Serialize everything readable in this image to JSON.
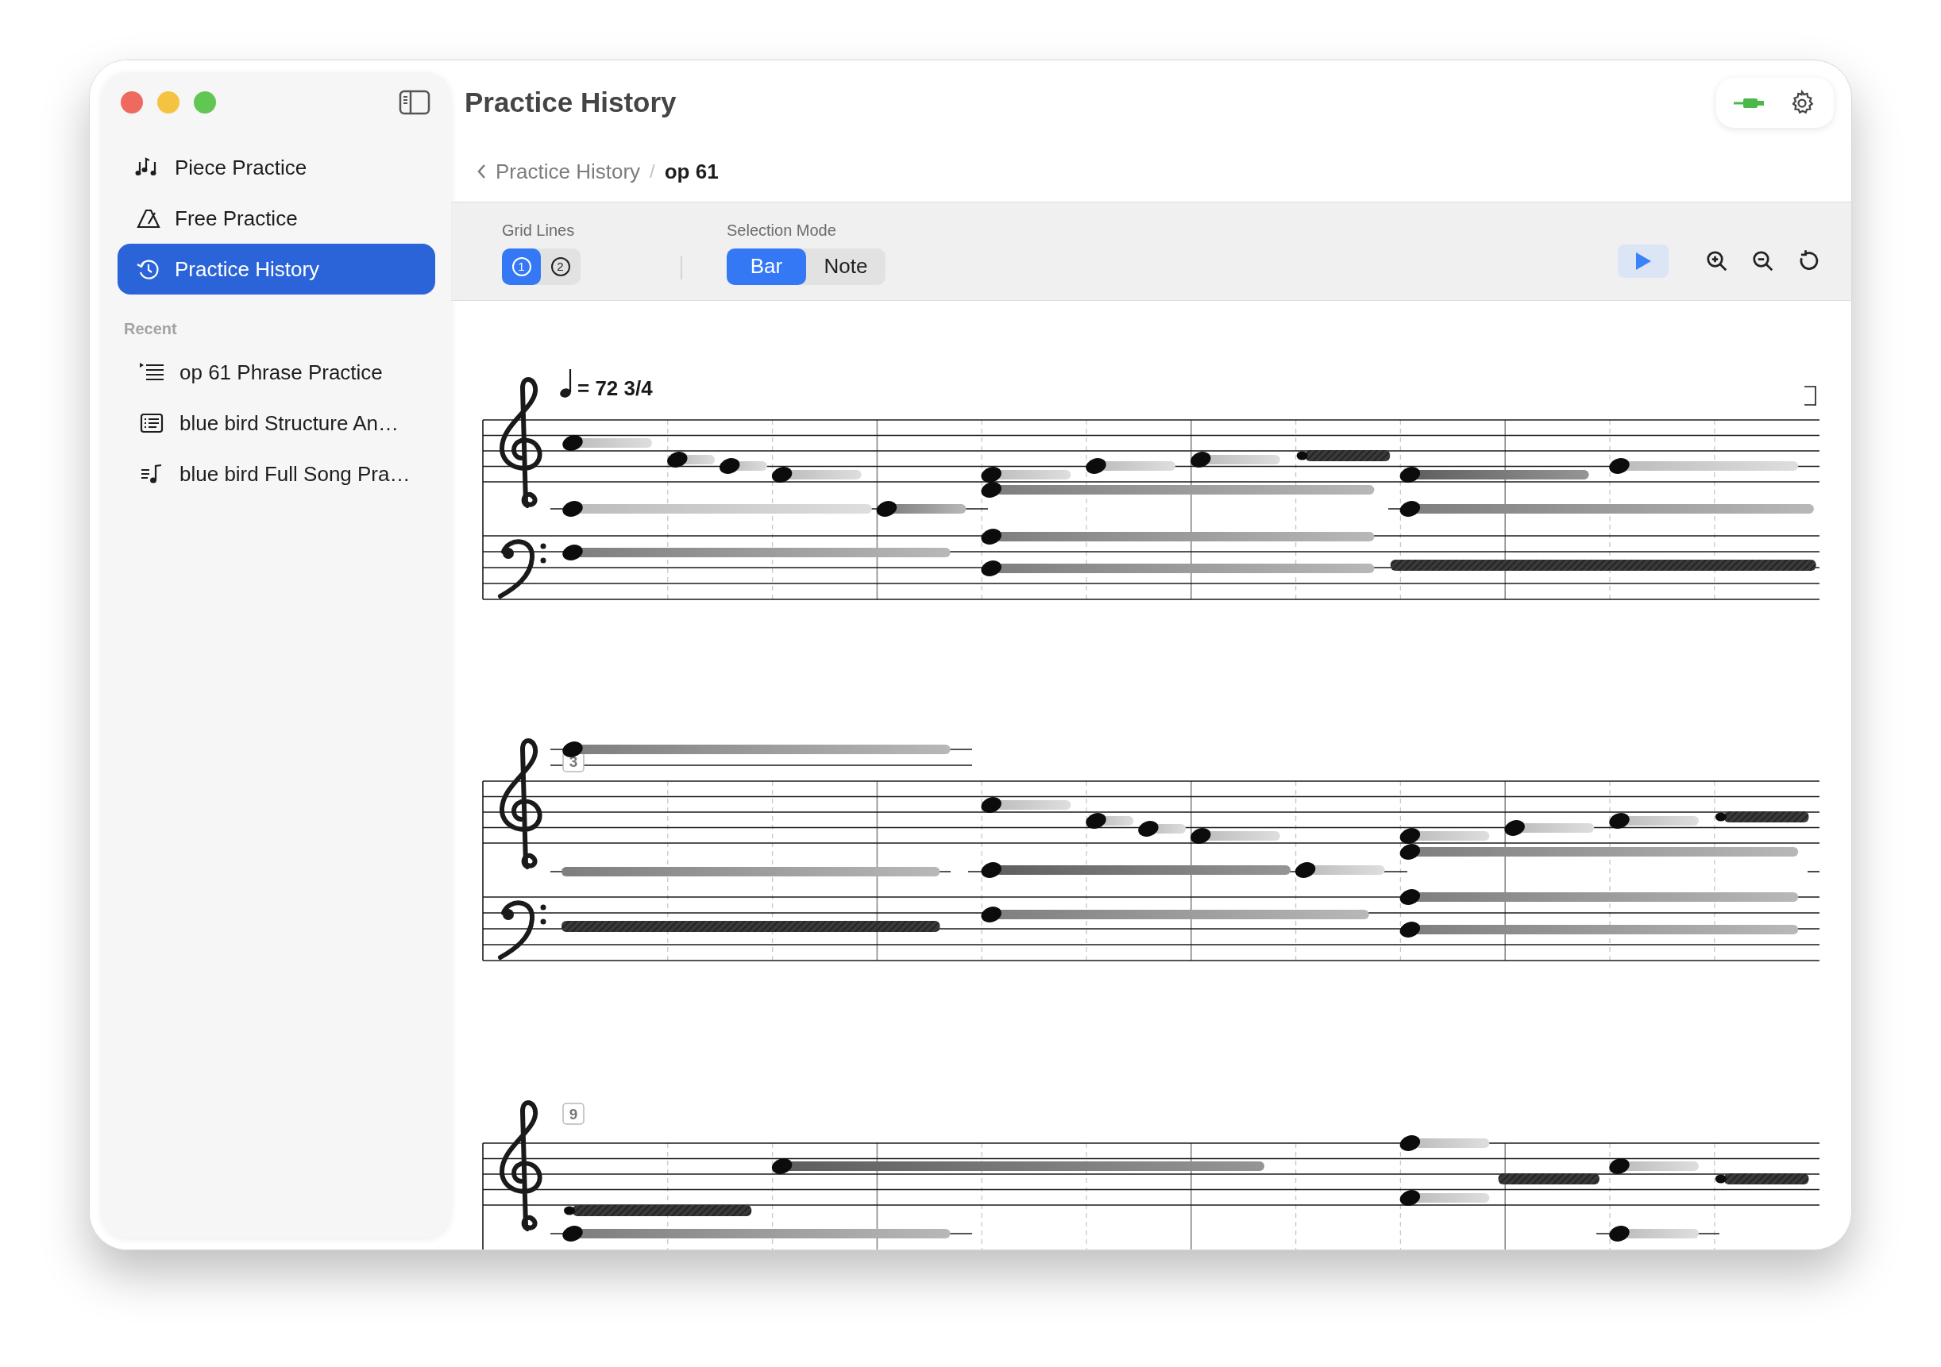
{
  "window": {
    "controls": [
      {
        "color": "#ee6a5f"
      },
      {
        "color": "#f5c342"
      },
      {
        "color": "#62c654"
      }
    ]
  },
  "sidebar": {
    "items": [
      {
        "label": "Piece Practice",
        "kind": "notes",
        "selected": false
      },
      {
        "label": "Free Practice",
        "kind": "metronome",
        "selected": false
      },
      {
        "label": "Practice History",
        "kind": "history",
        "selected": true
      }
    ],
    "recent": {
      "heading": "Recent",
      "items": [
        {
          "label": "op 61 Phrase Practice",
          "kind": "list"
        },
        {
          "label": "blue bird Structure An…",
          "kind": "document"
        },
        {
          "label": "blue bird Full Song Pra…",
          "kind": "music-list"
        }
      ]
    }
  },
  "header": {
    "title": "Practice History",
    "separator": "/",
    "breadcrumb": [
      {
        "label": "Practice History",
        "current": false
      },
      {
        "label": "op 61",
        "current": true
      }
    ]
  },
  "toolbar": {
    "grid_lines": {
      "label": "Grid Lines",
      "options": [
        {
          "label": "1",
          "selected": true
        },
        {
          "label": "2",
          "selected": false
        }
      ]
    },
    "selection_mode": {
      "label": "Selection Mode",
      "options": [
        {
          "label": "Bar",
          "selected": true
        },
        {
          "label": "Note",
          "selected": false
        }
      ]
    }
  },
  "score": {
    "tempo": "= 72 3/4",
    "measure_numbers": [
      "3",
      "9"
    ]
  }
}
